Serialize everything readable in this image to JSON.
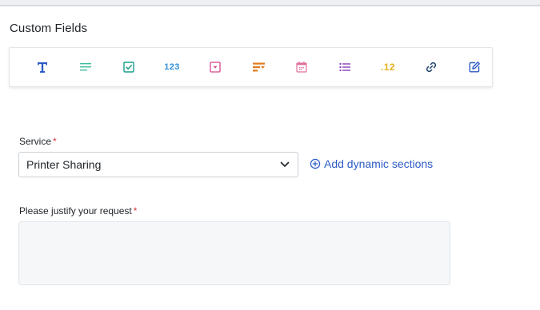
{
  "section": {
    "title": "Custom Fields"
  },
  "toolbar": {
    "tools": [
      {
        "icon": "text-field-icon",
        "color": "#2c5cc5"
      },
      {
        "icon": "paragraph-icon",
        "color": "#3fbf9f"
      },
      {
        "icon": "checkbox-icon",
        "color": "#1a9e8f"
      },
      {
        "icon": "number-icon",
        "text": "123",
        "color": "#2f8fd6"
      },
      {
        "icon": "dropdown-icon",
        "color": "#d6448a"
      },
      {
        "icon": "dependent-dropdown-icon",
        "color": "#e07b1f"
      },
      {
        "icon": "date-icon",
        "color": "#e0709c"
      },
      {
        "icon": "multi-select-icon",
        "color": "#8a3fb8"
      },
      {
        "icon": "decimal-icon",
        "text": ".12",
        "color": "#e8b021"
      },
      {
        "icon": "url-icon",
        "color": "#1d3d6e"
      },
      {
        "icon": "edit-icon",
        "color": "#2c5cc5"
      }
    ]
  },
  "form": {
    "service": {
      "label": "Service",
      "required_mark": "*",
      "value": "Printer Sharing"
    },
    "add_dynamic_sections": {
      "label": "Add dynamic sections"
    },
    "justify": {
      "label": "Please justify your request",
      "required_mark": "*",
      "value": ""
    }
  },
  "colors": {
    "link": "#2c5cc5",
    "required": "#d9363e",
    "textarea_bg": "#f5f7f9"
  }
}
